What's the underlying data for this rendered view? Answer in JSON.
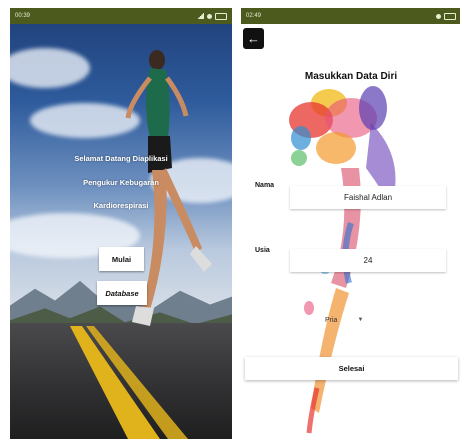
{
  "left_screen": {
    "status": {
      "time": "00:39"
    },
    "welcome_lines": [
      "Selamat Datang Diaplikasi",
      "Pengukur Kebugaran",
      "Kardiorespirasi"
    ],
    "buttons": {
      "start": "Mulai",
      "database": "Database"
    }
  },
  "right_screen": {
    "status": {
      "time": "02:49"
    },
    "title": "Masukkan Data Diri",
    "fields": {
      "name": {
        "label": "Nama",
        "value": "Faishal Adlan"
      },
      "age": {
        "label": "Usia",
        "value": "24"
      }
    },
    "gender_select": {
      "selected": "Pria"
    },
    "submit_label": "Selesai"
  },
  "icons": {
    "back": "arrow-left-icon",
    "dropdown": "caret-down-icon"
  }
}
